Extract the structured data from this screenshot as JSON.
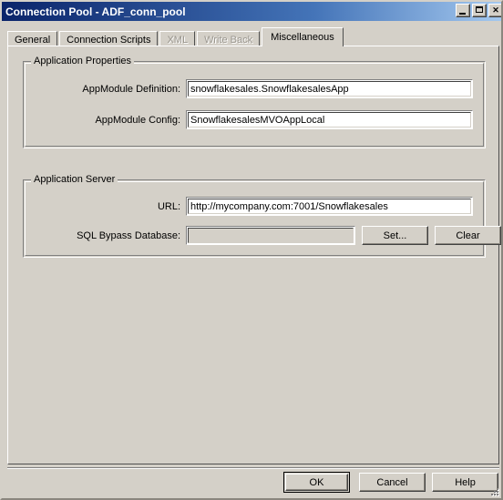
{
  "window": {
    "title": "Connection Pool - ADF_conn_pool",
    "controls": {
      "minimize_label": "Minimize",
      "maximize_label": "Maximize",
      "close_label": "Close",
      "close_glyph": "✕"
    }
  },
  "tabs": [
    {
      "label": "General",
      "selected": false,
      "disabled": false
    },
    {
      "label": "Connection Scripts",
      "selected": false,
      "disabled": false
    },
    {
      "label": "XML",
      "selected": false,
      "disabled": true
    },
    {
      "label": "Write Back",
      "selected": false,
      "disabled": true
    },
    {
      "label": "Miscellaneous",
      "selected": true,
      "disabled": false
    }
  ],
  "application_properties": {
    "group_title": "Application Properties",
    "appmodule_definition": {
      "label": "AppModule Definition:",
      "value": "snowflakesales.SnowflakesalesApp"
    },
    "appmodule_config": {
      "label": "AppModule Config:",
      "value": "SnowflakesalesMVOAppLocal"
    }
  },
  "application_server": {
    "group_title": "Application Server",
    "url": {
      "label": "URL:",
      "value": "http://mycompany.com:7001/Snowflakesales"
    },
    "sql_bypass_database": {
      "label": "SQL Bypass Database:",
      "value": ""
    },
    "set_button": "Set...",
    "clear_button": "Clear"
  },
  "footer": {
    "ok": "OK",
    "cancel": "Cancel",
    "help": "Help"
  },
  "colors": {
    "face": "#d4d0c8",
    "title_start": "#0a246a",
    "title_end": "#a6caf0",
    "disabled_text": "#9a968e"
  }
}
